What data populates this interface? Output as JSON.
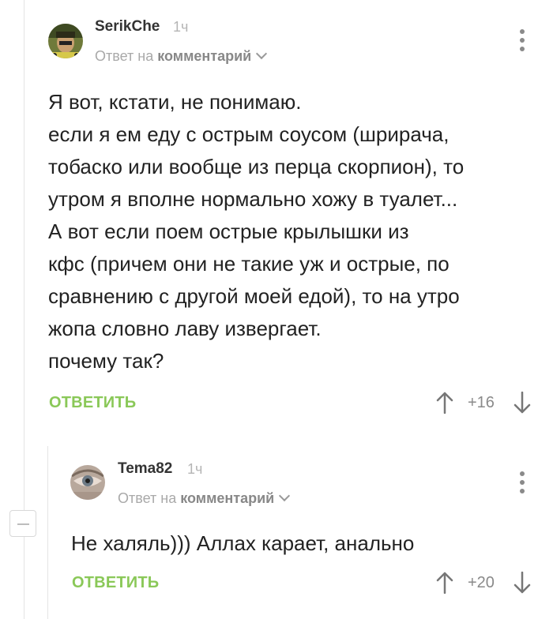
{
  "comments": [
    {
      "author": "SerikChe",
      "time": "1ч",
      "reply_prefix": "Ответ на",
      "reply_target": "комментарий",
      "body": "Я вот, кстати, не понимаю.\nесли я ем еду с острым соусом (шрирача,\nтобаско или вообще из перца скорпион), то\nутром я вполне нормально хожу в туалет...\nА вот если поем острые крылышки из\nкфс (причем они не такие уж и острые, по\nсравнению с другой моей едой), то на утро\nжопа словно лаву извергает.\nпочему так?",
      "reply_label": "ОТВЕТИТЬ",
      "score": "+16"
    },
    {
      "author": "Tema82",
      "time": "1ч",
      "reply_prefix": "Ответ на",
      "reply_target": "комментарий",
      "body": "Не халяль))) Аллах карает, анально",
      "reply_label": "ОТВЕТИТЬ",
      "score": "+20"
    }
  ],
  "colors": {
    "accent_green": "#8ac858",
    "muted_gray": "#a9a9a9",
    "thread_line": "#e4e4e4"
  },
  "icons": [
    "avatar",
    "chevron-down-icon",
    "kebab-menu-icon",
    "arrow-up-icon",
    "arrow-down-icon",
    "collapse-icon"
  ]
}
